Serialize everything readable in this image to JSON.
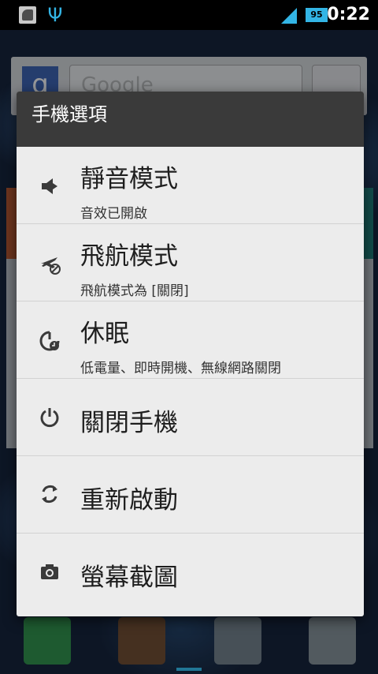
{
  "status_bar": {
    "battery_level": "95",
    "time": "0:22",
    "accent_color": "#33b5e5",
    "icons": [
      "notification-icon",
      "usb-icon",
      "signal-icon",
      "battery-icon"
    ]
  },
  "background": {
    "search_hint": "Google"
  },
  "dialog": {
    "title": "手機選項",
    "options": [
      {
        "title": "靜音模式",
        "subtitle": "音效已開啟",
        "icon": "sound-on-icon"
      },
      {
        "title": "飛航模式",
        "subtitle": "飛航模式為 [關閉]",
        "icon": "airplane-off-icon"
      },
      {
        "title": "休眠",
        "subtitle": "低電量、即時開機、無線網路關閉",
        "icon": "sleep-icon"
      },
      {
        "title": "關閉手機",
        "icon": "power-icon"
      },
      {
        "title": "重新啟動",
        "icon": "reboot-icon"
      },
      {
        "title": "螢幕截圖",
        "icon": "camera-icon"
      }
    ]
  }
}
